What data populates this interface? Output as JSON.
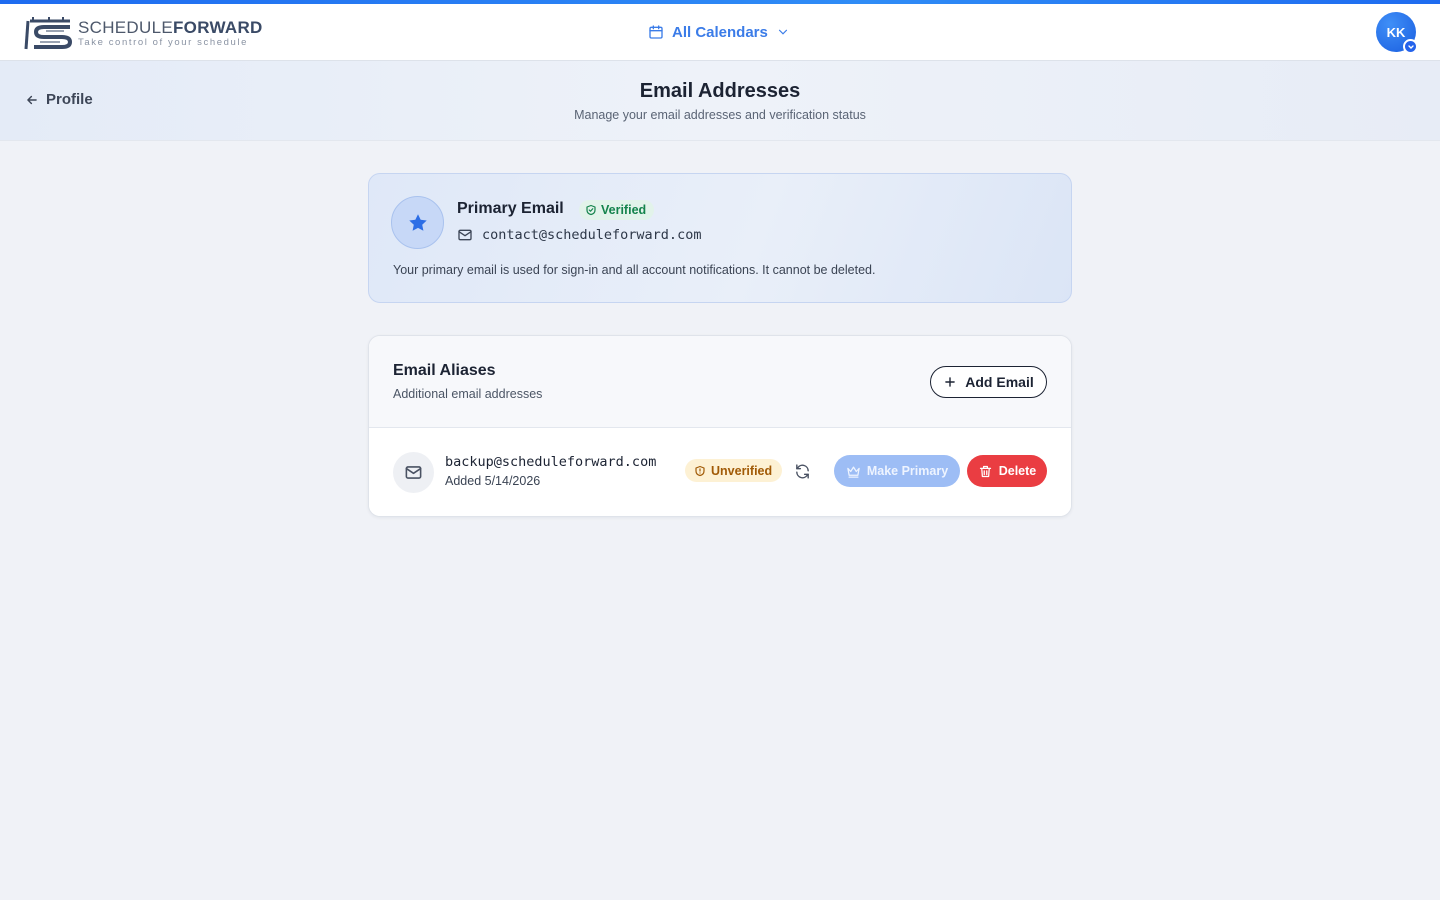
{
  "brand": {
    "name_light": "SCHEDULE",
    "name_bold": "FORWARD",
    "tagline": "Take control of your schedule",
    "accent": "#1e6bf0"
  },
  "nav": {
    "calendar_selector": "All Calendars",
    "avatar_initials": "KK"
  },
  "subheader": {
    "back_label": "Profile",
    "title": "Email Addresses",
    "subtitle": "Manage your email addresses and verification status"
  },
  "primary": {
    "title": "Primary Email",
    "status": "Verified",
    "email": "contact@scheduleforward.com",
    "note": "Your primary email is used for sign-in and all account notifications. It cannot be deleted."
  },
  "aliases": {
    "title": "Email Aliases",
    "subtitle": "Additional email addresses",
    "add_label": "Add Email",
    "items": [
      {
        "email": "backup@scheduleforward.com",
        "added": "Added 5/14/2026",
        "status": "Unverified",
        "make_primary_label": "Make Primary",
        "delete_label": "Delete"
      }
    ]
  },
  "icons": [
    "calendar-icon",
    "chevron-down-icon",
    "arrow-left-icon",
    "star-icon",
    "shield-check-icon",
    "mail-icon",
    "plus-icon",
    "shield-alert-icon",
    "refresh-icon",
    "crown-icon",
    "trash-icon"
  ],
  "colors": {
    "verified": "#14834c",
    "unverified": "#a15a06",
    "delete": "#ea3d42",
    "make_primary_disabled": "#9dbdf5"
  }
}
